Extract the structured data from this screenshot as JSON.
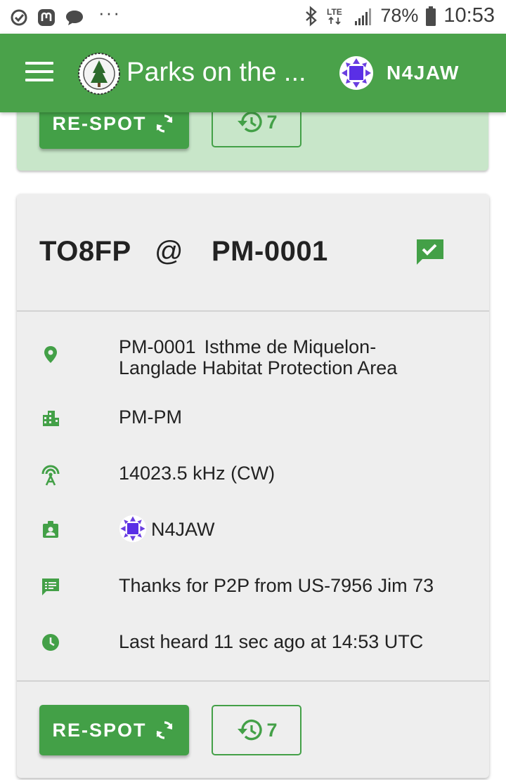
{
  "status_bar": {
    "left_icons": [
      "check-circle-icon",
      "mastodon-icon",
      "chat-bubble-icon"
    ],
    "overflow": "···",
    "right_icons": [
      "bluetooth-icon",
      "lte-icon",
      "signal-icon"
    ],
    "network_label": "LTE",
    "battery_percent": "78%",
    "time": "10:53"
  },
  "app_bar": {
    "title": "Parks on the ...",
    "user_callsign": "N4JAW"
  },
  "previous_card": {
    "respot_label": "RE-SPOT",
    "history_count": "7"
  },
  "spot": {
    "callsign": "TO8FP",
    "at": "@",
    "reference": "PM-0001",
    "park_ref": "PM-0001",
    "park_name_line1": "Isthme de Miquelon-",
    "park_name_line2": "Langlade Habitat Protection Area",
    "location": "PM-PM",
    "frequency": "14023.5 kHz (CW)",
    "spotter": "N4JAW",
    "comment": "Thanks for P2P from US-7956 Jim 73",
    "last_heard": "Last heard 11 sec ago at 14:53 UTC",
    "respot_label": "RE-SPOT",
    "history_count": "7"
  },
  "colors": {
    "app_bar": "#4aa24a",
    "accent": "#43a047",
    "previous_card_bg": "#c8e6c9",
    "card_bg": "#eeeeee"
  }
}
